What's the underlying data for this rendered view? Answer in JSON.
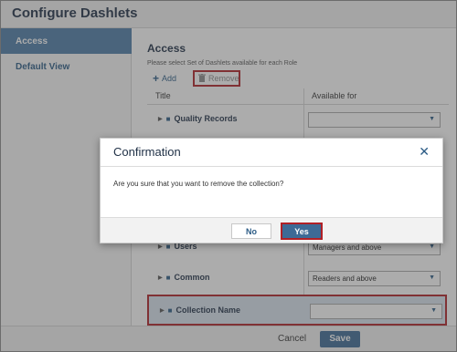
{
  "window": {
    "title": "Configure Dashlets"
  },
  "sidebar": {
    "items": [
      {
        "label": "Access",
        "active": true
      },
      {
        "label": "Default View",
        "active": false
      }
    ]
  },
  "content": {
    "title": "Access",
    "subtitle": "Please select Set of Dashlets available for each Role",
    "toolbar": {
      "add_label": "Add",
      "remove_label": "Remove"
    },
    "table": {
      "headers": {
        "title": "Title",
        "available_for": "Available for"
      },
      "rows": [
        {
          "name": "Quality Records",
          "available_for": ""
        },
        {
          "name": "Users",
          "available_for": "Managers and above"
        },
        {
          "name": "Common",
          "available_for": "Readers and above"
        },
        {
          "name": "Collection Name",
          "available_for": ""
        }
      ]
    }
  },
  "footer": {
    "cancel_label": "Cancel",
    "save_label": "Save"
  },
  "dialog": {
    "title": "Confirmation",
    "message": "Are you sure that you want to remove the collection?",
    "no_label": "No",
    "yes_label": "Yes"
  },
  "icons": {
    "add": "plus-icon",
    "remove": "trash-icon",
    "folder": "folder-icon",
    "expand": "caret-right-icon",
    "dropdown": "chevron-down-icon",
    "close": "close-icon"
  },
  "colors": {
    "accent": "#3d6a96",
    "highlight_border": "#b02026",
    "sidebar_active": "#4e7ca8"
  }
}
